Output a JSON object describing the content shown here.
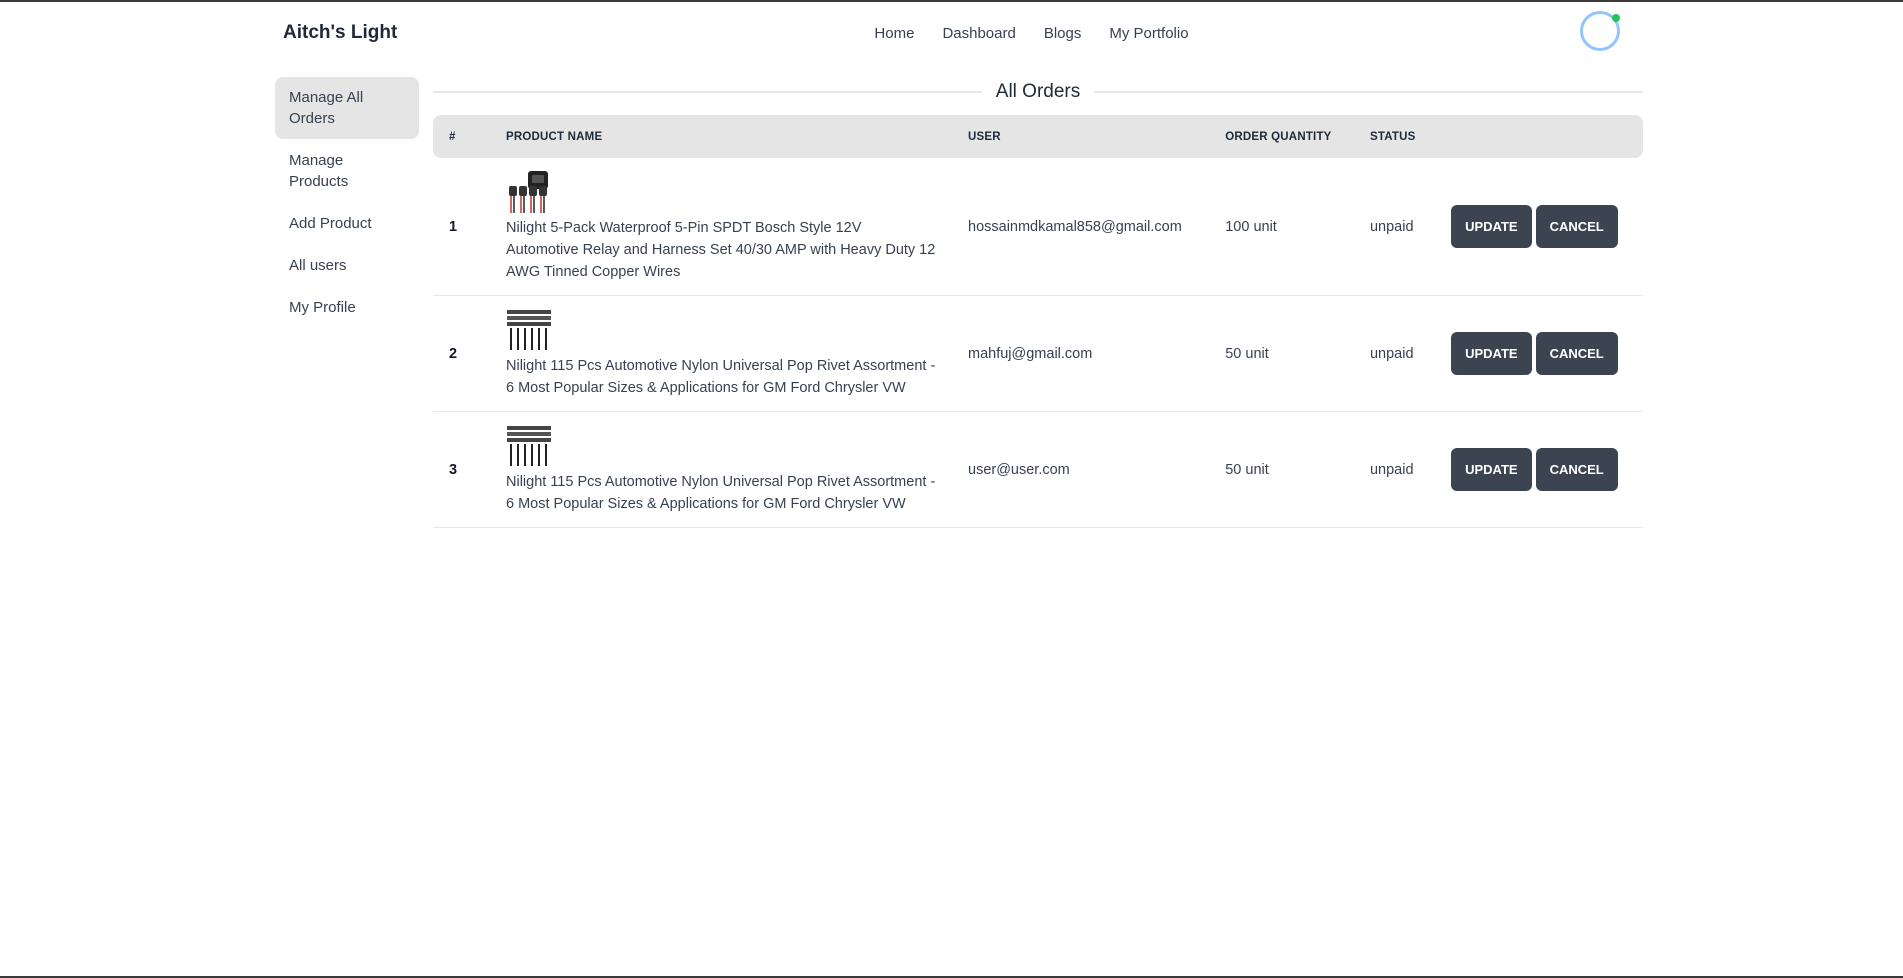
{
  "navbar": {
    "brand": "Aitch's Light",
    "links": [
      "Home",
      "Dashboard",
      "Blogs",
      "My Portfolio"
    ]
  },
  "sidebar": {
    "items": [
      {
        "label": "Manage All Orders",
        "active": true
      },
      {
        "label": "Manage Products",
        "active": false
      },
      {
        "label": "Add Product",
        "active": false
      },
      {
        "label": "All users",
        "active": false
      },
      {
        "label": "My Profile",
        "active": false
      }
    ]
  },
  "main": {
    "title": "All Orders",
    "columns": [
      "#",
      "PRODUCT NAME",
      "USER",
      "ORDER QUANTITY",
      "STATUS"
    ],
    "rows": [
      {
        "index": "1",
        "product": "Nilight 5-Pack Waterproof 5-Pin SPDT Bosch Style 12V Automotive Relay and Harness Set 40/30 AMP with Heavy Duty 12 AWG Tinned Copper Wires",
        "product_image": "relay-harness-image",
        "user": "hossainmdkamal858@gmail.com",
        "quantity": "100 unit",
        "status": "unpaid",
        "update_label": "Update",
        "cancel_label": "Cancel"
      },
      {
        "index": "2",
        "product": "Nilight 115 Pcs Automotive Nylon Universal Pop Rivet Assortment - 6 Most Popular Sizes & Applications for GM Ford Chrysler VW",
        "product_image": "rivet-assortment-image",
        "user": "mahfuj@gmail.com",
        "quantity": "50 unit",
        "status": "unpaid",
        "update_label": "Update",
        "cancel_label": "Cancel"
      },
      {
        "index": "3",
        "product": "Nilight 115 Pcs Automotive Nylon Universal Pop Rivet Assortment - 6 Most Popular Sizes & Applications for GM Ford Chrysler VW",
        "product_image": "rivet-assortment-image",
        "user": "user@user.com",
        "quantity": "50 unit",
        "status": "unpaid",
        "update_label": "Update",
        "cancel_label": "Cancel"
      }
    ]
  },
  "colors": {
    "button_bg": "#3d4451",
    "header_bg": "#e5e5e5",
    "avatar_ring": "#93c5fd",
    "online_dot": "#22c55e"
  }
}
